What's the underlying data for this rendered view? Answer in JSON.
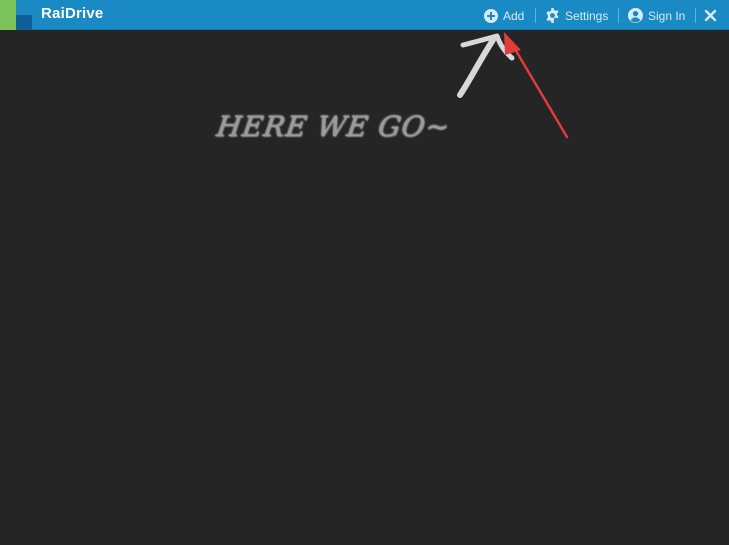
{
  "app": {
    "title": "RaiDrive"
  },
  "toolbar": {
    "add_label": "Add",
    "settings_label": "Settings",
    "signin_label": "Sign In"
  },
  "annotation": {
    "text": "HERE WE GO~"
  },
  "colors": {
    "titlebar": "#1a8ac4",
    "background": "#252525",
    "toolbar_text": "#d6ebf7",
    "arrow_red": "#e23b3b"
  },
  "icons": {
    "add": "plus-circle-icon",
    "settings": "gear-icon",
    "signin": "user-circle-icon",
    "close": "close-icon"
  }
}
